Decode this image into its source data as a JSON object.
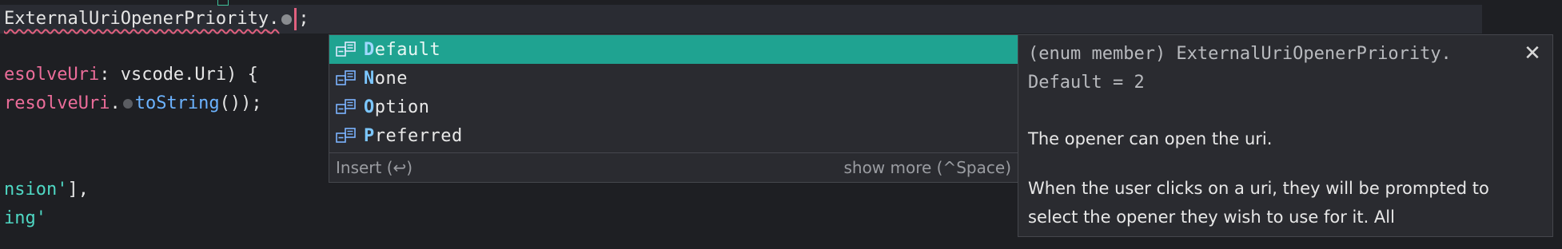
{
  "editor": {
    "line1": {
      "class_name": "ExternalUriOpenerPriority",
      "dot_char": ".",
      "semicolon": ";"
    },
    "line2": {
      "text_a": "esolveUri",
      "text_b": ": vscode.Uri) {"
    },
    "line3": {
      "text_a": "resolveUri",
      "text_b": ".",
      "method": "toString",
      "text_c": "());"
    },
    "line4": {
      "str": "nsion'",
      "rest": "],"
    },
    "line5": {
      "str": "ing'"
    }
  },
  "suggest": {
    "items": [
      {
        "first": "D",
        "rest": "efault",
        "icon": "enum-member-icon",
        "selected": true
      },
      {
        "first": "N",
        "rest": "one",
        "icon": "enum-member-icon",
        "selected": false
      },
      {
        "first": "O",
        "rest": "ption",
        "icon": "enum-member-icon",
        "selected": false
      },
      {
        "first": "P",
        "rest": "referred",
        "icon": "enum-member-icon",
        "selected": false
      }
    ],
    "footer_left": "Insert (↩)",
    "footer_right": "show more (^Space)"
  },
  "details": {
    "signature": "(enum member) ExternalUriOpenerPriority.\nDefault = 2",
    "close_label": "✕",
    "doc_p1": "The opener can open the uri.",
    "doc_p2": "When the user clicks on a uri, they will be prompted to select the opener they wish to use for it. All"
  },
  "colors": {
    "selected_row": "#1fa391",
    "string": "#4fd8c4",
    "identifier": "#ec6d9a",
    "method": "#6cb3ff",
    "squiggle": "#e0607e"
  }
}
